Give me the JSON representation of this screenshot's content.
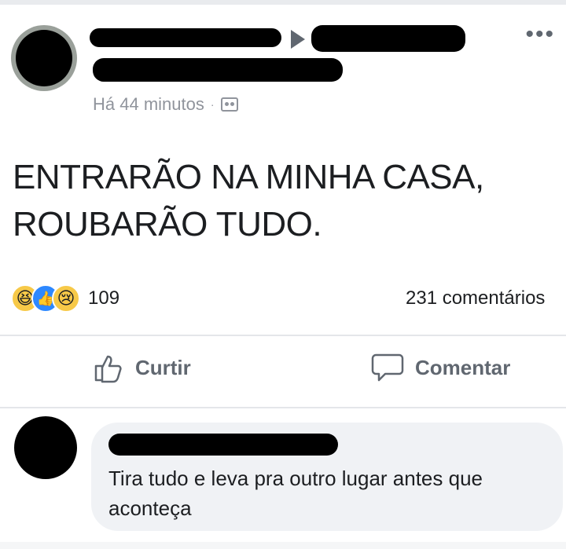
{
  "post": {
    "timestamp": "Há 44 minutos",
    "separator": "·",
    "audience_icon": "public-icon",
    "text_lines": [
      "ENTRARÃO NA MINHA CASA,",
      "ROUBARÃO TUDO."
    ]
  },
  "reactions": {
    "icons": [
      "haha-emoji",
      "like-icon",
      "sad-emoji"
    ],
    "count": "109",
    "comments": "231 comentários"
  },
  "actions": {
    "like_label": "Curtir",
    "comment_label": "Comentar"
  },
  "comment": {
    "text": "Tira tudo e leva pra outro lugar antes que aconteça"
  },
  "colors": {
    "meta_gray": "#90949c",
    "action_gray": "#606770",
    "bubble_bg": "#f0f2f5",
    "like_blue": "#2d88ff",
    "emoji_yellow": "#f7c948"
  }
}
